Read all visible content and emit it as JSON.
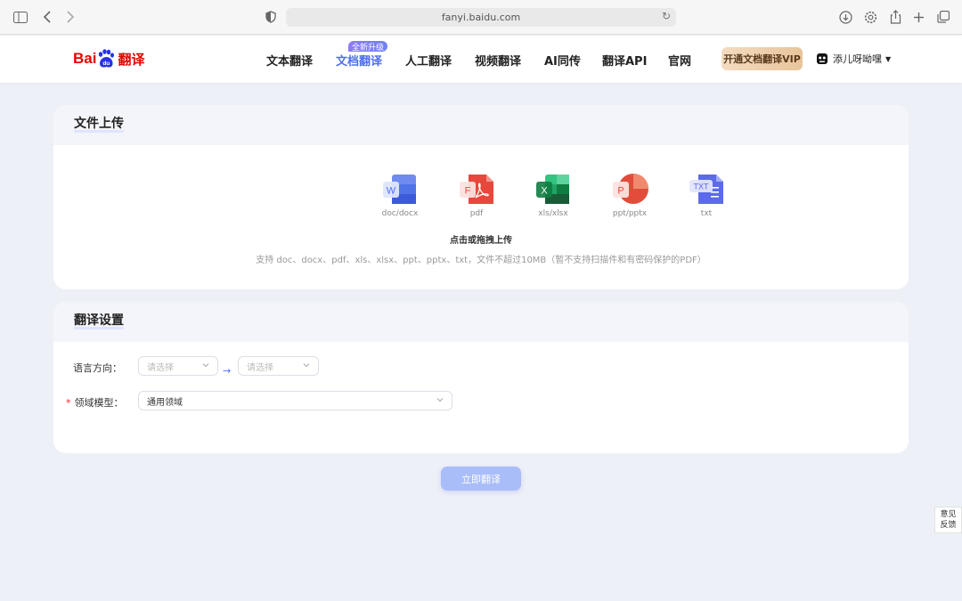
{
  "browser": {
    "url": "fanyi.baidu.com"
  },
  "header": {
    "logo_bai": "Bai",
    "logo_du": "du",
    "logo_cn": "翻译",
    "nav": [
      {
        "label": "文本翻译"
      },
      {
        "label": "文档翻译",
        "badge": "全新升级",
        "active": true
      },
      {
        "label": "人工翻译"
      },
      {
        "label": "视频翻译"
      },
      {
        "label": "AI同传"
      },
      {
        "label": "翻译API"
      },
      {
        "label": "官网"
      }
    ],
    "vip_label": "开通文档翻译VIP",
    "username": "添儿呀呦嘿"
  },
  "upload": {
    "title": "文件上传",
    "file_types": [
      {
        "label": "doc/docx",
        "icon": "word-icon",
        "letter": "W",
        "color": "#3b5bdb"
      },
      {
        "label": "pdf",
        "icon": "pdf-icon",
        "letter": "F",
        "color": "#e8483c"
      },
      {
        "label": "xls/xlsx",
        "icon": "excel-icon",
        "letter": "X",
        "color": "#21a366"
      },
      {
        "label": "ppt/pptx",
        "icon": "ppt-icon",
        "letter": "P",
        "color": "#e24c3a"
      },
      {
        "label": "txt",
        "icon": "txt-icon",
        "letter": "TXT",
        "color": "#5b6bea"
      }
    ],
    "action_text": "点击或拖拽上传",
    "hint": "支持 doc、docx、pdf、xls、xlsx、ppt、pptx、txt，文件不超过10MB（暂不支持扫描件和有密码保护的PDF）"
  },
  "settings": {
    "title": "翻译设置",
    "language_label": "语言方向：",
    "source_placeholder": "请选择",
    "target_placeholder": "请选择",
    "domain_label": "领域模型：",
    "domain_value": "通用领域"
  },
  "translate_button": "立即翻译",
  "feedback": {
    "line1": "意见",
    "line2": "反馈"
  },
  "colors": {
    "accent": "#4e6ef2",
    "brand_red": "#e10602"
  }
}
